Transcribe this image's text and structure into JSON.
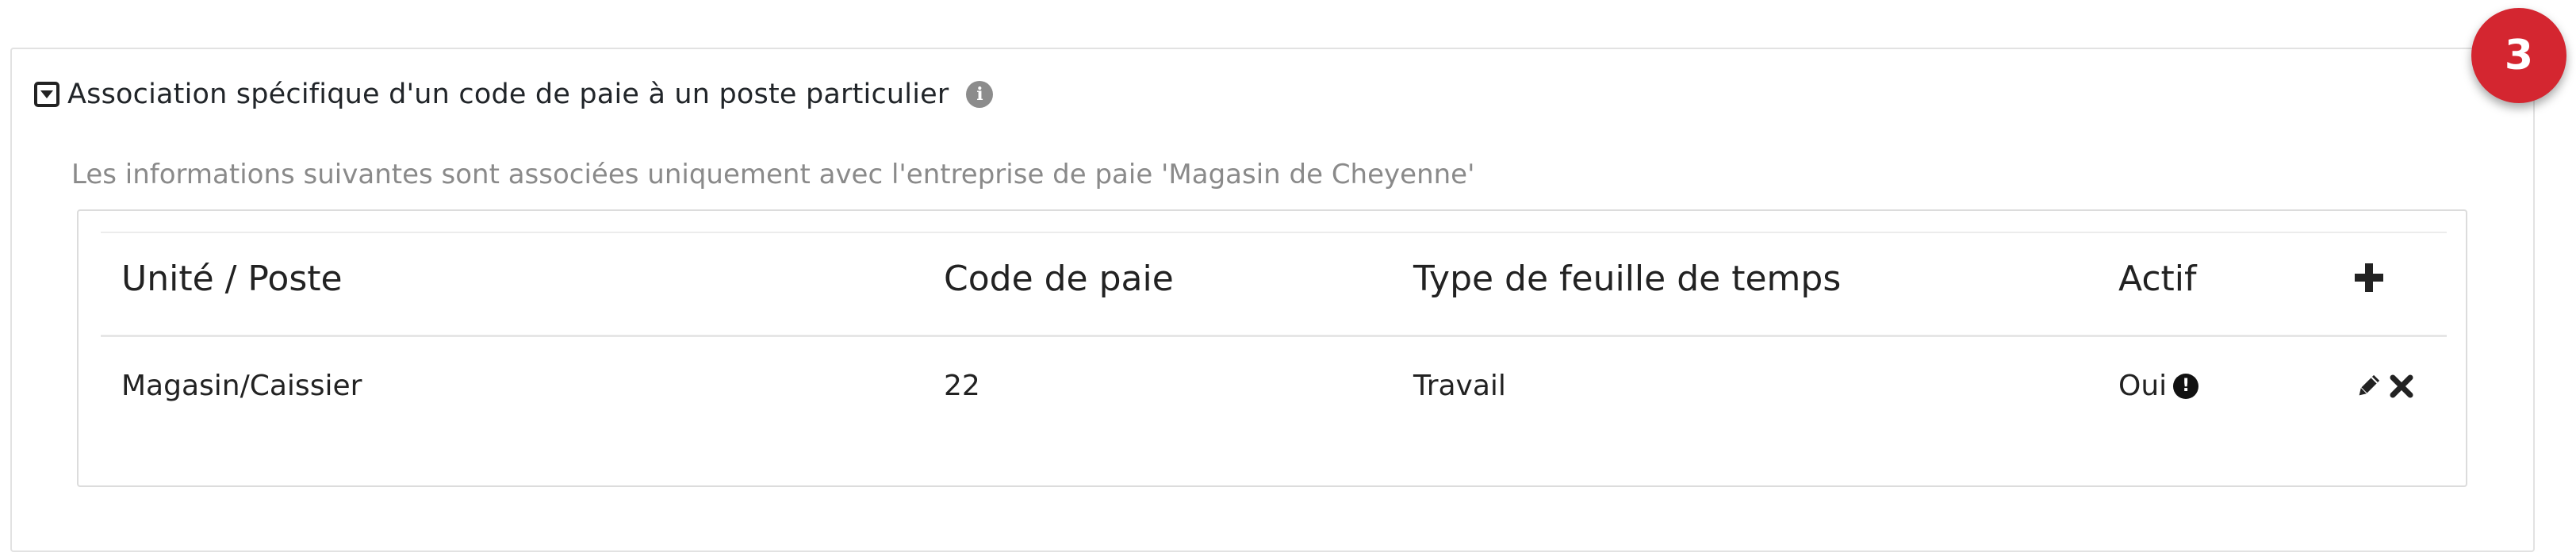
{
  "panel": {
    "title": "Association spécifique d'un code de paie à un poste particulier",
    "subtitle": "Les informations suivantes sont associées uniquement avec l'entreprise de paie 'Magasin de Cheyenne'",
    "collapse_icon": "collapse-square-icon",
    "info_icon_glyph": "i"
  },
  "table": {
    "columns": [
      "Unité / Poste",
      "Code de paie",
      "Type de feuille de temps",
      "Actif"
    ],
    "rows": [
      {
        "unit": "Magasin/Caissier",
        "pay_code": "22",
        "timesheet_type": "Travail",
        "active": "Oui",
        "active_icon_glyph": "!"
      }
    ]
  },
  "badge": {
    "label": "3",
    "color": "#d42630"
  }
}
